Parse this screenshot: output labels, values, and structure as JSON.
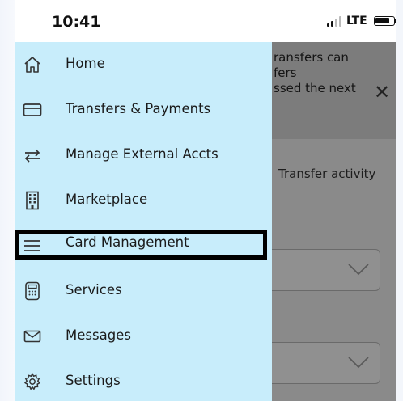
{
  "status_bar": {
    "time": "10:41",
    "network": "LTE"
  },
  "drawer": {
    "items": [
      {
        "label": "Home",
        "icon": "home-icon"
      },
      {
        "label": "Transfers & Payments",
        "icon": "credit-card-icon"
      },
      {
        "label": "Manage External Accts",
        "icon": "swap-arrows-icon"
      },
      {
        "label": "Marketplace",
        "icon": "building-icon"
      },
      {
        "label": "Card Management",
        "icon": "hamburger-menu-icon"
      },
      {
        "label": "Services",
        "icon": "calculator-icon"
      },
      {
        "label": "Messages",
        "icon": "envelope-icon"
      },
      {
        "label": "Settings",
        "icon": "gear-icon"
      }
    ],
    "highlighted_item": "Card Management",
    "background_color": "#c8edfb"
  },
  "underlay": {
    "banner_lines": [
      "ransfers can",
      "fers",
      "ssed the next"
    ],
    "close_symbol": "✕",
    "activity_text": "Transfer activity"
  },
  "colors": {
    "overlay": "#8a8a8a",
    "highlight_border": "#000000"
  }
}
